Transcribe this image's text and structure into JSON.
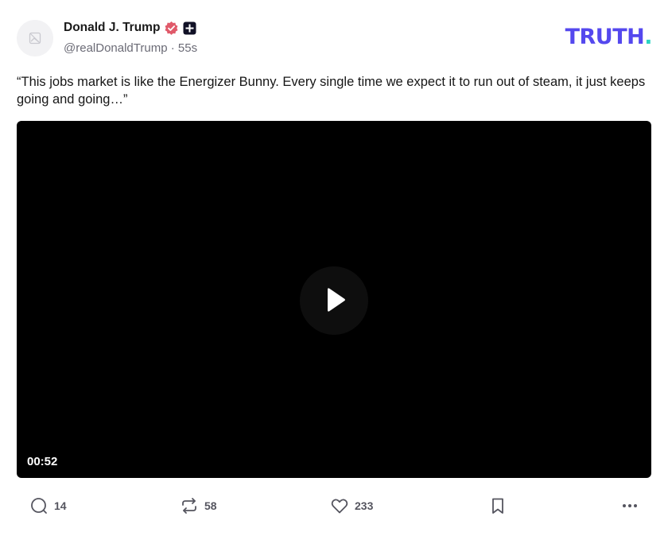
{
  "author": {
    "display_name": "Donald J. Trump",
    "handle": "@realDonaldTrump",
    "separator": "·",
    "time_ago": "55s",
    "verified_color": "#e05a6a"
  },
  "brand": {
    "logo_main": "TRUTH",
    "logo_dot": ".",
    "primary_color": "#5448ee",
    "accent_color": "#2bd4c2"
  },
  "post": {
    "text": "“This jobs market is like the Energizer Bunny. Every single time we expect it to run out of steam, it just keeps going and going…”"
  },
  "video": {
    "duration": "00:52",
    "play_icon": "play-icon"
  },
  "actions": {
    "reply_count": "14",
    "retruth_count": "58",
    "like_count": "233",
    "icons": [
      "reply-icon",
      "retruth-icon",
      "like-icon",
      "bookmark-icon",
      "more-icon"
    ]
  }
}
